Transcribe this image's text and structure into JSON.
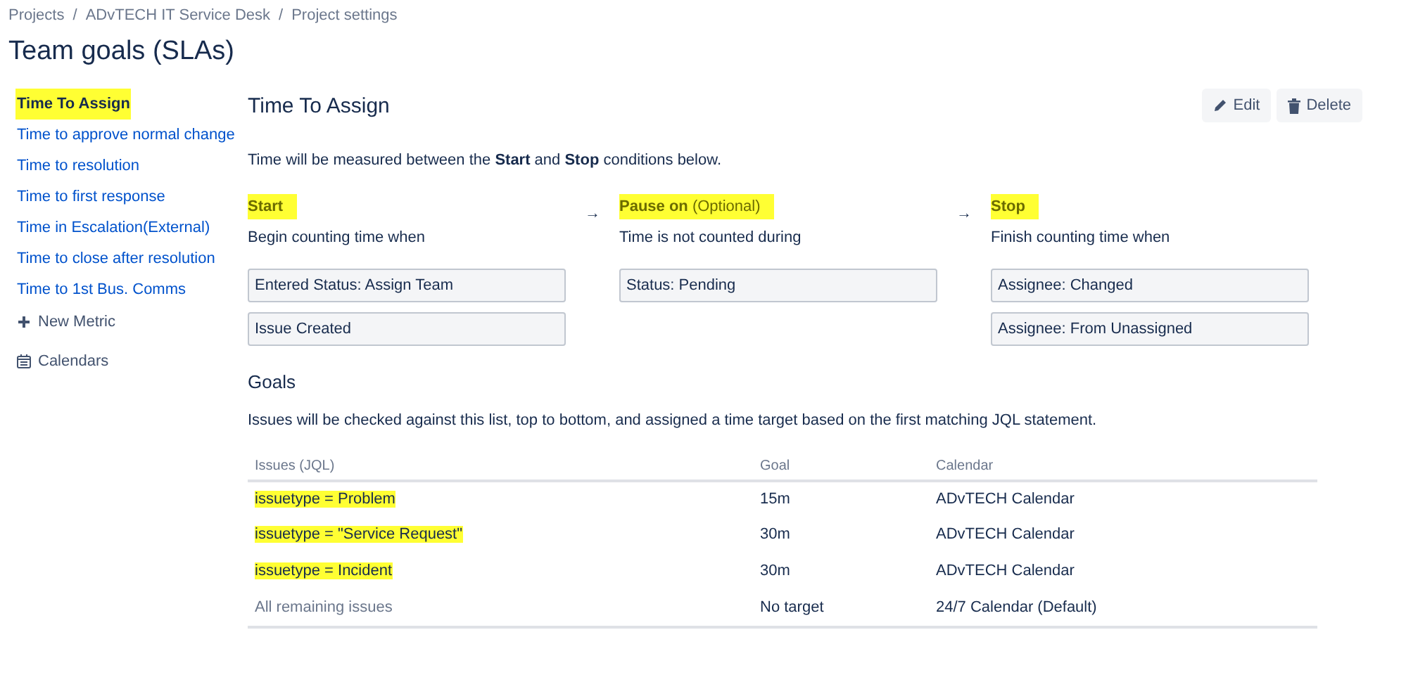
{
  "breadcrumbs": [
    "Projects",
    "ADvTECH IT Service Desk",
    "Project settings"
  ],
  "breadcrumb_separators": [
    "/",
    "/"
  ],
  "page_title": "Team goals (SLAs)",
  "sidebar": {
    "items": [
      {
        "label": "Time To Assign",
        "selected": true,
        "highlighted": true
      },
      {
        "label": "Time to approve normal change",
        "selected": false,
        "highlighted": false
      },
      {
        "label": "Time to resolution",
        "selected": false,
        "highlighted": false
      },
      {
        "label": "Time to first response",
        "selected": false,
        "highlighted": false
      },
      {
        "label": "Time in Escalation(External)",
        "selected": false,
        "highlighted": false
      },
      {
        "label": "Time to close after resolution",
        "selected": false,
        "highlighted": false
      },
      {
        "label": "Time to 1st Bus. Comms",
        "selected": false,
        "highlighted": false
      }
    ],
    "actions": [
      {
        "kind": "add",
        "label": "New Metric"
      },
      {
        "kind": "calendar",
        "label": "Calendars"
      }
    ]
  },
  "metric": {
    "title": "Time To Assign",
    "buttons": [
      {
        "kind": "edit",
        "label": "Edit"
      },
      {
        "kind": "delete",
        "label": "Delete"
      }
    ],
    "description": "Time will be measured between the **Start** and **Stop** conditions below.",
    "conditions": [
      {
        "heading": "**Start**",
        "highlighted": true,
        "subtitle": "Begin counting time when",
        "values": [
          "Entered Status: Assign Team",
          "Issue Created"
        ]
      },
      {
        "heading": "**Pause on** (Optional)",
        "highlighted": true,
        "subtitle": "Time is not counted during",
        "values": [
          "Status: Pending"
        ]
      },
      {
        "heading": "**Stop**",
        "highlighted": true,
        "subtitle": "Finish counting time when",
        "values": [
          "Assignee: Changed",
          "Assignee: From Unassigned"
        ]
      }
    ],
    "separators": [
      "→",
      "→"
    ]
  },
  "goals": {
    "title": "Goals",
    "description": "Issues will be checked against this list, top to bottom, and assigned a time target based on the first matching JQL statement.",
    "columns": [
      "Issues (JQL)",
      "Goal",
      "Calendar"
    ],
    "rows": [
      {
        "kind": "jql",
        "issues": "issuetype = Problem",
        "highlighted": true,
        "goal": "15m",
        "calendar": "ADvTECH Calendar"
      },
      {
        "kind": "jql",
        "issues": "issuetype = \"Service Request\"",
        "highlighted": true,
        "goal": "30m",
        "calendar": "ADvTECH Calendar"
      },
      {
        "kind": "jql",
        "issues": "issuetype = Incident",
        "highlighted": true,
        "goal": "30m",
        "calendar": "ADvTECH Calendar"
      },
      {
        "kind": "default",
        "issues": "All remaining issues",
        "highlighted": false,
        "goal": "No target",
        "calendar": "24/7 Calendar (Default)"
      }
    ]
  }
}
